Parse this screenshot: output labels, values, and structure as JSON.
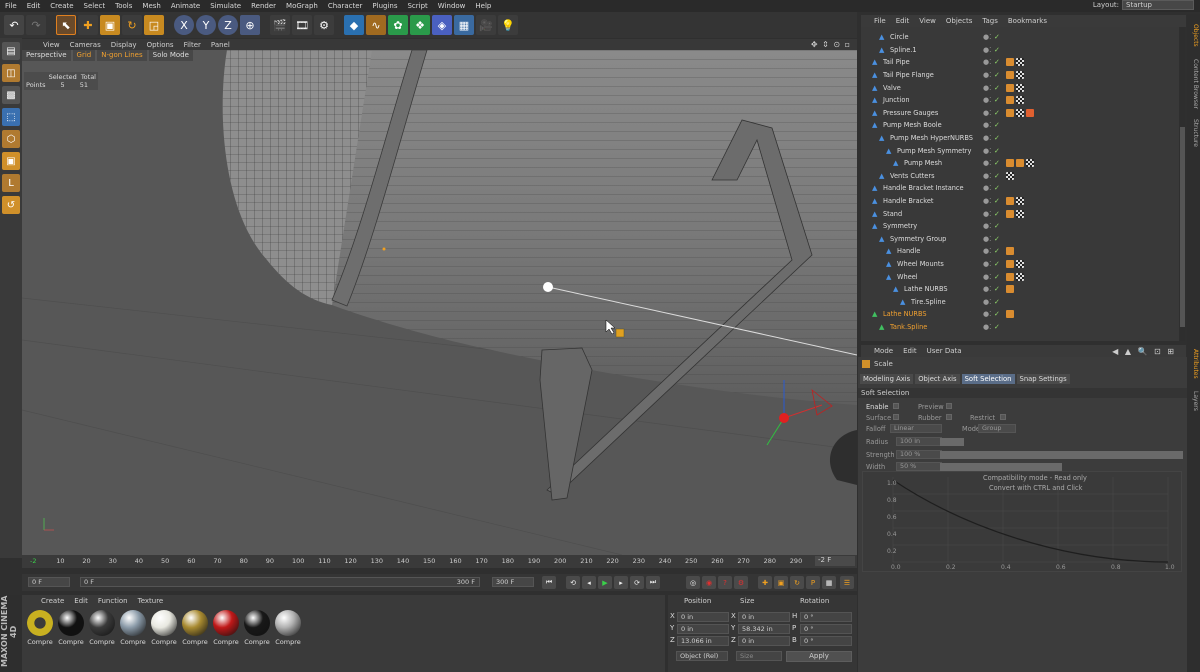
{
  "menubar": {
    "items": [
      "File",
      "Edit",
      "Create",
      "Select",
      "Tools",
      "Mesh",
      "Animate",
      "Simulate",
      "Render",
      "MoGraph",
      "Character",
      "Plugins",
      "Script",
      "Window",
      "Help"
    ],
    "layout_label": "Layout:",
    "layout_value": "Startup"
  },
  "viewport": {
    "menu": [
      "View",
      "Cameras",
      "Display",
      "Options",
      "Filter",
      "Panel"
    ],
    "view_name": "Perspective",
    "toggles": [
      "Grid",
      "N-gon Lines",
      "Solo Mode"
    ],
    "stats": {
      "header_selected": "Selected",
      "header_total": "Total",
      "row_label": "Points",
      "selected": "5",
      "total": "51"
    }
  },
  "timeline": {
    "ticks": [
      "-2",
      "10",
      "20",
      "30",
      "40",
      "50",
      "60",
      "70",
      "80",
      "90",
      "100",
      "110",
      "120",
      "130",
      "140",
      "150",
      "160",
      "170",
      "180",
      "190",
      "200",
      "210",
      "220",
      "230",
      "240",
      "250",
      "260",
      "270",
      "280",
      "290",
      "300"
    ],
    "frame_end": "-2 F"
  },
  "transport": {
    "current": "0 F",
    "start": "0 F",
    "range_end": "300 F",
    "end": "300 F"
  },
  "materials": {
    "menu": [
      "Create",
      "Edit",
      "Function",
      "Texture"
    ],
    "items": [
      {
        "label": "Compre",
        "color": "#c8b020"
      },
      {
        "label": "Compre",
        "color": "#111111"
      },
      {
        "label": "Compre",
        "color": "#3a3a3a"
      },
      {
        "label": "Compre",
        "color": "#8a9aa8"
      },
      {
        "label": "Compre",
        "color": "#e8e8e0"
      },
      {
        "label": "Compre",
        "color": "#a88a30"
      },
      {
        "label": "Compre",
        "color": "#c01818"
      },
      {
        "label": "Compre",
        "color": "#181818"
      },
      {
        "label": "Compre",
        "color": "#b0b0b0"
      }
    ]
  },
  "brand": "MAXON CINEMA 4D",
  "coordinates": {
    "headers": [
      "Position",
      "Size",
      "Rotation"
    ],
    "rows": [
      {
        "axis": "X",
        "pos": "0 in",
        "size_axis": "X",
        "size": "0 in",
        "rot_axis": "H",
        "rot": "0 °"
      },
      {
        "axis": "Y",
        "pos": "0 in",
        "size_axis": "Y",
        "size": "58.342 in",
        "rot_axis": "P",
        "rot": "0 °"
      },
      {
        "axis": "Z",
        "pos": "13.066 in",
        "size_axis": "Z",
        "size": "0 in",
        "rot_axis": "B",
        "rot": "0 °"
      }
    ],
    "mode": "Object (Rel)",
    "size_mode": "Size",
    "apply": "Apply"
  },
  "objects": {
    "menu": [
      "File",
      "Edit",
      "View",
      "Objects",
      "Tags",
      "Bookmarks"
    ],
    "items": [
      {
        "name": "Circle",
        "indent": 2,
        "tags": [],
        "orange": false
      },
      {
        "name": "Spline.1",
        "indent": 2,
        "tags": [],
        "orange": false
      },
      {
        "name": "Tail Pipe",
        "indent": 1,
        "tags": [
          "t1",
          "t2"
        ],
        "orange": false
      },
      {
        "name": "Tail Pipe Flange",
        "indent": 1,
        "tags": [
          "t1",
          "t2"
        ],
        "orange": false
      },
      {
        "name": "Valve",
        "indent": 1,
        "tags": [
          "t1",
          "t2"
        ],
        "orange": false
      },
      {
        "name": "Junction",
        "indent": 1,
        "tags": [
          "t1",
          "t2"
        ],
        "orange": false
      },
      {
        "name": "Pressure Gauges",
        "indent": 1,
        "tags": [
          "t1",
          "t2",
          "t3"
        ],
        "orange": false
      },
      {
        "name": "Pump Mesh Boole",
        "indent": 1,
        "tags": [],
        "orange": false
      },
      {
        "name": "Pump Mesh HyperNURBS",
        "indent": 2,
        "tags": [],
        "orange": false
      },
      {
        "name": "Pump Mesh Symmetry",
        "indent": 3,
        "tags": [],
        "orange": false
      },
      {
        "name": "Pump Mesh",
        "indent": 4,
        "tags": [
          "t1",
          "t1",
          "t2"
        ],
        "orange": false
      },
      {
        "name": "Vents Cutters",
        "indent": 2,
        "tags": [
          "t2"
        ],
        "orange": false
      },
      {
        "name": "Handle Bracket Instance",
        "indent": 1,
        "tags": [],
        "orange": false
      },
      {
        "name": "Handle Bracket",
        "indent": 1,
        "tags": [
          "t1",
          "t2"
        ],
        "orange": false
      },
      {
        "name": "Stand",
        "indent": 1,
        "tags": [
          "t1",
          "t2"
        ],
        "orange": false
      },
      {
        "name": "Symmetry",
        "indent": 1,
        "tags": [],
        "orange": false
      },
      {
        "name": "Symmetry Group",
        "indent": 2,
        "tags": [],
        "orange": false
      },
      {
        "name": "Handle",
        "indent": 3,
        "tags": [
          "t1"
        ],
        "orange": false
      },
      {
        "name": "Wheel Mounts",
        "indent": 3,
        "tags": [
          "t1",
          "t2"
        ],
        "orange": false
      },
      {
        "name": "Wheel",
        "indent": 3,
        "tags": [
          "t1",
          "t2"
        ],
        "orange": false
      },
      {
        "name": "Lathe NURBS",
        "indent": 4,
        "tags": [
          "t1"
        ],
        "orange": false
      },
      {
        "name": "Tire.Spline",
        "indent": 5,
        "tags": [],
        "orange": false
      },
      {
        "name": "Lathe NURBS",
        "indent": 1,
        "tags": [
          "t1"
        ],
        "orange": true
      },
      {
        "name": "Tank.Spline",
        "indent": 2,
        "tags": [],
        "orange": true
      }
    ]
  },
  "attributes": {
    "menu": [
      "Mode",
      "Edit",
      "User Data"
    ],
    "tool": "Scale",
    "tabs": [
      "Modeling Axis",
      "Object Axis",
      "Soft Selection",
      "Snap Settings"
    ],
    "active_tab": "Soft Selection",
    "section": "Soft Selection",
    "enable": "Enable",
    "preview": "Preview",
    "surface": "Surface",
    "rubber": "Rubber",
    "restrict": "Restrict",
    "falloff_label": "Falloff",
    "falloff": "Linear",
    "mode_label": "Mode",
    "mode": "Group",
    "radius_label": "Radius",
    "radius": "100 in",
    "strength_label": "Strength",
    "strength": "100 %",
    "width_label": "Width",
    "width": "50 %",
    "graph_note1": "Compatibility mode - Read only",
    "graph_note2": "Convert with CTRL and Click",
    "graph_y": [
      "1.0",
      "0.8",
      "0.6",
      "0.4",
      "0.2"
    ],
    "graph_x": [
      "0.0",
      "0.2",
      "0.4",
      "0.6",
      "0.8",
      "1.0"
    ]
  },
  "side_tabs": [
    "Objects",
    "Content Browser",
    "Structure",
    "Attributes",
    "Layers"
  ]
}
